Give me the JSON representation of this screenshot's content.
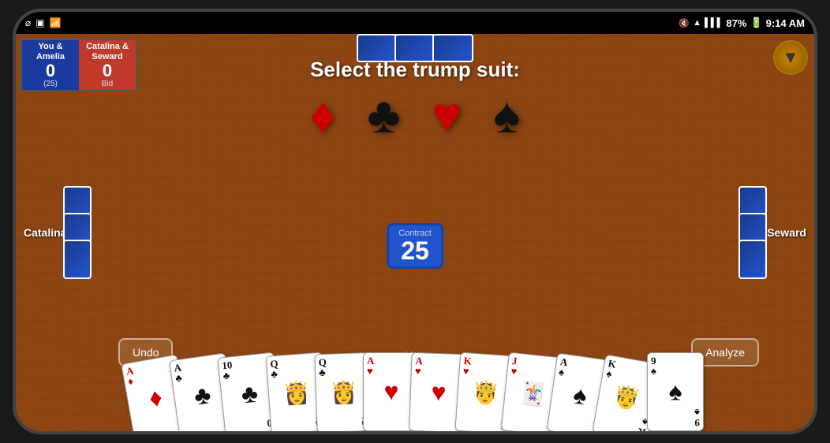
{
  "statusBar": {
    "time": "9:14 AM",
    "battery": "87%",
    "icons": [
      "usb",
      "sim",
      "wifi"
    ]
  },
  "game": {
    "mode": "Standard",
    "players": {
      "top": "Amelia",
      "left": "Catalina",
      "right": "Seward",
      "bottom": "You"
    },
    "scores": {
      "team1": {
        "name": "You &\nAmelia",
        "score": "0",
        "bid": "(25)"
      },
      "team2": {
        "name": "Catalina &\nSeward",
        "score": "0",
        "bid": "Bid"
      }
    },
    "contract": {
      "label": "Contract",
      "value": "25"
    },
    "trumpPrompt": "Select the trump suit:",
    "suits": [
      {
        "symbol": "♦",
        "color": "red",
        "name": "diamonds"
      },
      {
        "symbol": "♣",
        "color": "black",
        "name": "clubs"
      },
      {
        "symbol": "♥",
        "color": "red",
        "name": "hearts"
      },
      {
        "symbol": "♠",
        "color": "black",
        "name": "spades"
      }
    ],
    "buttons": {
      "undo": "Undo",
      "analyze": "Analyze"
    },
    "hand": [
      {
        "rank": "A",
        "suit": "♦",
        "color": "red",
        "display": "face"
      },
      {
        "rank": "A",
        "suit": "♣",
        "color": "black",
        "display": "face"
      },
      {
        "rank": "10",
        "suit": "♣",
        "color": "black",
        "display": "pip"
      },
      {
        "rank": "Q",
        "suit": "♣",
        "color": "black",
        "display": "figure"
      },
      {
        "rank": "Q",
        "suit": "♣",
        "color": "black",
        "display": "figure"
      },
      {
        "rank": "A",
        "suit": "♥",
        "color": "red",
        "display": "face"
      },
      {
        "rank": "A",
        "suit": "♥",
        "color": "red",
        "display": "face"
      },
      {
        "rank": "K",
        "suit": "♥",
        "color": "red",
        "display": "figure"
      },
      {
        "rank": "J",
        "suit": "♥",
        "color": "red",
        "display": "figure"
      },
      {
        "rank": "A",
        "suit": "♠",
        "color": "black",
        "display": "face"
      },
      {
        "rank": "K",
        "suit": "♠",
        "color": "black",
        "display": "figure"
      },
      {
        "rank": "9",
        "suit": "♠",
        "color": "black",
        "display": "pip"
      }
    ]
  }
}
